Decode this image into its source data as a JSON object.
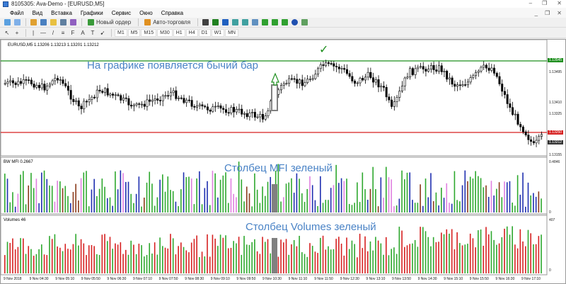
{
  "window": {
    "title": "8105305: Ava-Demo - [EURUSD,M5]",
    "controls": [
      "–",
      "❐",
      "✕"
    ]
  },
  "menu": {
    "items": [
      "Файл",
      "Вид",
      "Вставка",
      "Графики",
      "Сервис",
      "Окно",
      "Справка"
    ],
    "doc_controls": [
      "_",
      "❐",
      "✕"
    ]
  },
  "toolbar": {
    "new_order_label": "Новый ордер",
    "autotrade_label": "Авто-торговля",
    "timeframes": [
      "M1",
      "M5",
      "M15",
      "M30",
      "H1",
      "H4",
      "D1",
      "W1",
      "MN"
    ]
  },
  "chart": {
    "symbol_line": "EURUSD,M5  1.13206 1.13213 1.13201 1.13212",
    "annotation_main": "На графике появляется бычий бар",
    "checkmark": "✓",
    "price_labels": [
      {
        "text": "1.13545",
        "style": "gl"
      },
      {
        "text": "1.13495",
        "style": ""
      },
      {
        "text": "1.13410",
        "style": ""
      },
      {
        "text": "1.13325",
        "style": ""
      },
      {
        "text": "1.13250",
        "style": "hl"
      },
      {
        "text": "1.13212",
        "style": "bk"
      },
      {
        "text": "1.13155",
        "style": ""
      }
    ]
  },
  "bwmfi": {
    "title": "BW MFI 0.2667",
    "annotation": "Столбец MFI зеленый",
    "scale_top": "0.4846",
    "scale_bottom": "0"
  },
  "volumes": {
    "title": "Volumes 46",
    "annotation": "Столбец Volumes зеленый",
    "scale_top": "407",
    "scale_bottom": "0"
  },
  "time_axis": [
    "9 Nov 2018",
    "9 Nov 04:30",
    "9 Nov 05:10",
    "9 Nov 05:50",
    "9 Nov 06:30",
    "9 Nov 07:10",
    "9 Nov 07:50",
    "9 Nov 08:30",
    "9 Nov 09:10",
    "9 Nov 09:50",
    "9 Nov 10:30",
    "9 Nov 11:10",
    "9 Nov 11:50",
    "9 Nov 12:30",
    "9 Nov 13:10",
    "9 Nov 13:50",
    "9 Nov 14:30",
    "9 Nov 15:10",
    "9 Nov 15:50",
    "9 Nov 16:30",
    "9 Nov 17:10"
  ],
  "colors": {
    "bull": "#ffffff",
    "bear": "#000000",
    "resistance_line": "#1f8f1f",
    "support_line": "#d62020",
    "highlight": "#808080",
    "mfi_green": "#2ea82e",
    "mfi_blue": "#1f2fb0",
    "mfi_brown": "#8a3a1a",
    "mfi_pink": "#e080e0",
    "vol_green": "#2ea82e",
    "vol_red": "#d62020",
    "annotation": "#4a83c6"
  }
}
